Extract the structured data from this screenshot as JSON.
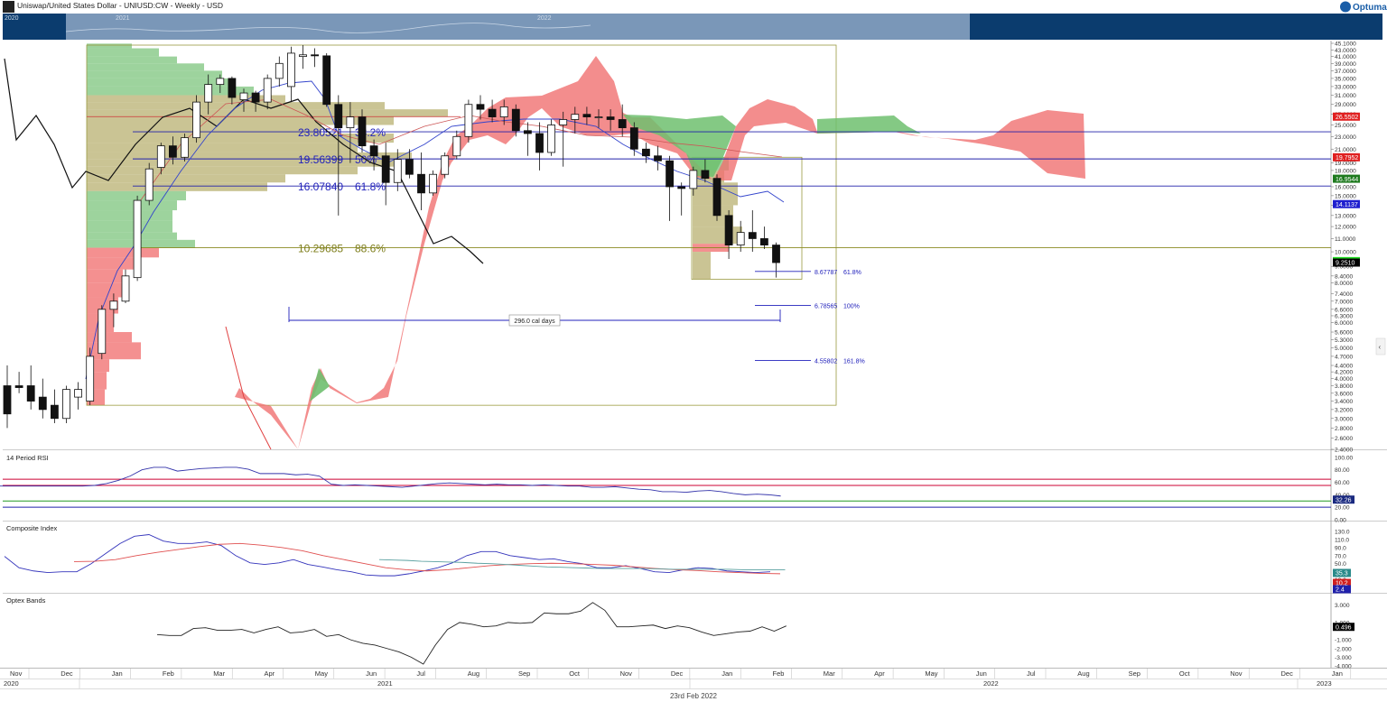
{
  "header": {
    "title": "Uniswap/United States Dollar - UNIUSD:CW - Weekly - USD",
    "brand": "Optuma",
    "nav_year_a": "2020",
    "nav_year_b": "2021",
    "nav_year_c": "2022",
    "footer_date": "23rd Feb 2022"
  },
  "colors": {
    "navigator_bg": "#0b3c6e",
    "navigator_window": "#7a97b8",
    "fib_blue": "#2222bb",
    "fib_olive": "#7d7d1a",
    "cloud_green": "#6fbf6f",
    "cloud_red": "#f07070",
    "volume_olive": "#b8b070",
    "volume_green": "#7cc47c",
    "volume_red": "#f06b6b",
    "rsi_line": "#3333aa",
    "ci_blue": "#3333bb",
    "ci_red": "#e05050",
    "ci_teal": "#5aa0a0",
    "optex_line": "#222222"
  },
  "fib_retracements": [
    {
      "price": "23.80521",
      "pct": "38.2%"
    },
    {
      "price": "19.56399",
      "pct": "50%"
    },
    {
      "price": "16.07840",
      "pct": "61.8%"
    },
    {
      "price": "10.29685",
      "pct": "88.6%"
    }
  ],
  "fib_extensions": [
    {
      "price": "8.67787",
      "pct": "61.8%"
    },
    {
      "price": "6.78565",
      "pct": "100%"
    },
    {
      "price": "4.55802",
      "pct": "161.8%"
    }
  ],
  "date_range_label": "296.0 cal days",
  "price_axis": {
    "ticks": [
      "45.1000",
      "43.0000",
      "41.0000",
      "39.0000",
      "37.0000",
      "35.0000",
      "33.0000",
      "31.0000",
      "29.0000",
      "27.0000",
      "25.0000",
      "23.0000",
      "21.0000",
      "19.0000",
      "18.0000",
      "16.0000",
      "15.0000",
      "14.0000",
      "13.0000",
      "12.0000",
      "11.0000",
      "10.0000",
      "9.0000",
      "8.4000",
      "8.0000",
      "7.4000",
      "7.0000",
      "6.6000",
      "6.3000",
      "6.0000",
      "5.6000",
      "5.3000",
      "5.0000",
      "4.7000",
      "4.4000",
      "4.2000",
      "4.0000",
      "3.8000",
      "3.6000",
      "3.4000",
      "3.2000",
      "3.0000",
      "2.8000",
      "2.6000",
      "2.4000"
    ],
    "badges": [
      {
        "text": "26.5502",
        "price": 26.5502,
        "color": "#e02020",
        "fg": "#ffffff"
      },
      {
        "text": "19.7952",
        "price": 19.7952,
        "color": "#e02020",
        "fg": "#ffffff"
      },
      {
        "text": "16.9544",
        "price": 16.9544,
        "color": "#1e7a1e",
        "fg": "#ffffff"
      },
      {
        "text": "14.1137",
        "price": 14.1137,
        "color": "#1f1fcf",
        "fg": "#ffffff"
      },
      {
        "text": "9.3510",
        "price": 9.351,
        "color": "#22dd22",
        "fg": "#000000"
      },
      {
        "text": "9.2510",
        "price": 9.251,
        "color": "#000000",
        "fg": "#ffffff"
      }
    ]
  },
  "chart_data": [
    {
      "type": "candlestick",
      "title": "Uniswap/United States Dollar - UNIUSD:CW - Weekly - USD",
      "scale": "log",
      "ylim": [
        2.4,
        45.1
      ],
      "horizontal_levels": [
        {
          "price": 23.80521,
          "label": "38.2%"
        },
        {
          "price": 19.56399,
          "label": "50%"
        },
        {
          "price": 16.0784,
          "label": "61.8%"
        },
        {
          "price": 10.29685,
          "label": "88.6%"
        }
      ],
      "candles": [
        {
          "o": 3.8,
          "h": 4.4,
          "l": 2.8,
          "c": 3.1
        },
        {
          "o": 3.8,
          "h": 4.2,
          "l": 3.6,
          "c": 3.75
        },
        {
          "o": 3.8,
          "h": 4.4,
          "l": 3.2,
          "c": 3.4
        },
        {
          "o": 3.5,
          "h": 4.0,
          "l": 3.0,
          "c": 3.2
        },
        {
          "o": 3.3,
          "h": 3.7,
          "l": 2.9,
          "c": 3.0
        },
        {
          "o": 3.0,
          "h": 3.8,
          "l": 2.9,
          "c": 3.7
        },
        {
          "o": 3.5,
          "h": 3.9,
          "l": 3.2,
          "c": 3.7
        },
        {
          "o": 3.4,
          "h": 5.0,
          "l": 3.3,
          "c": 4.7
        },
        {
          "o": 4.8,
          "h": 6.8,
          "l": 4.6,
          "c": 6.6
        },
        {
          "o": 6.6,
          "h": 7.4,
          "l": 5.8,
          "c": 7.0
        },
        {
          "o": 7.0,
          "h": 8.8,
          "l": 6.9,
          "c": 8.4
        },
        {
          "o": 8.3,
          "h": 15.0,
          "l": 8.1,
          "c": 14.5
        },
        {
          "o": 14.5,
          "h": 19.0,
          "l": 14.0,
          "c": 18.2
        },
        {
          "o": 18.4,
          "h": 22.0,
          "l": 17.5,
          "c": 21.5
        },
        {
          "o": 21.5,
          "h": 23.0,
          "l": 18.8,
          "c": 19.8
        },
        {
          "o": 19.8,
          "h": 23.5,
          "l": 19.2,
          "c": 22.8
        },
        {
          "o": 22.8,
          "h": 31.0,
          "l": 22.0,
          "c": 29.5
        },
        {
          "o": 29.5,
          "h": 36.0,
          "l": 27.0,
          "c": 33.5
        },
        {
          "o": 33.5,
          "h": 36.0,
          "l": 31.5,
          "c": 35.0
        },
        {
          "o": 35.0,
          "h": 35.5,
          "l": 29.0,
          "c": 30.5
        },
        {
          "o": 30.0,
          "h": 32.5,
          "l": 27.5,
          "c": 31.5
        },
        {
          "o": 31.5,
          "h": 32.0,
          "l": 27.5,
          "c": 29.5
        },
        {
          "o": 29.5,
          "h": 36.0,
          "l": 28.0,
          "c": 35.0
        },
        {
          "o": 35.0,
          "h": 41.0,
          "l": 33.0,
          "c": 39.0
        },
        {
          "o": 33.0,
          "h": 44.0,
          "l": 29.5,
          "c": 42.0
        },
        {
          "o": 41.0,
          "h": 44.5,
          "l": 37.5,
          "c": 41.5
        },
        {
          "o": 41.5,
          "h": 43.5,
          "l": 38.0,
          "c": 41.2
        },
        {
          "o": 41.2,
          "h": 42.0,
          "l": 28.5,
          "c": 29.0
        },
        {
          "o": 29.0,
          "h": 31.0,
          "l": 13.0,
          "c": 24.5
        },
        {
          "o": 24.5,
          "h": 29.5,
          "l": 19.0,
          "c": 26.5
        },
        {
          "o": 26.5,
          "h": 28.0,
          "l": 20.5,
          "c": 21.5
        },
        {
          "o": 21.5,
          "h": 22.5,
          "l": 18.0,
          "c": 20.0
        },
        {
          "o": 20.0,
          "h": 22.0,
          "l": 14.0,
          "c": 16.5
        },
        {
          "o": 16.5,
          "h": 21.0,
          "l": 15.5,
          "c": 19.5
        },
        {
          "o": 19.5,
          "h": 21.0,
          "l": 17.0,
          "c": 17.5
        },
        {
          "o": 17.5,
          "h": 20.5,
          "l": 13.5,
          "c": 15.3
        },
        {
          "o": 15.3,
          "h": 18.0,
          "l": 15.0,
          "c": 17.5
        },
        {
          "o": 17.5,
          "h": 20.5,
          "l": 17.0,
          "c": 20.0
        },
        {
          "o": 20.0,
          "h": 24.0,
          "l": 19.5,
          "c": 23.0
        },
        {
          "o": 23.0,
          "h": 30.0,
          "l": 22.0,
          "c": 29.0
        },
        {
          "o": 29.0,
          "h": 31.0,
          "l": 26.0,
          "c": 28.0
        },
        {
          "o": 28.0,
          "h": 30.0,
          "l": 25.5,
          "c": 26.5
        },
        {
          "o": 26.5,
          "h": 30.0,
          "l": 25.0,
          "c": 28.5
        },
        {
          "o": 28.0,
          "h": 29.0,
          "l": 23.0,
          "c": 24.0
        },
        {
          "o": 24.0,
          "h": 25.5,
          "l": 20.0,
          "c": 23.5
        },
        {
          "o": 23.5,
          "h": 25.5,
          "l": 18.0,
          "c": 20.5
        },
        {
          "o": 20.5,
          "h": 26.0,
          "l": 20.0,
          "c": 25.0
        },
        {
          "o": 25.0,
          "h": 27.5,
          "l": 18.5,
          "c": 26.0
        },
        {
          "o": 26.0,
          "h": 28.5,
          "l": 23.5,
          "c": 27.0
        },
        {
          "o": 27.0,
          "h": 28.5,
          "l": 25.0,
          "c": 26.5
        },
        {
          "o": 26.5,
          "h": 28.0,
          "l": 24.5,
          "c": 26.5
        },
        {
          "o": 26.5,
          "h": 28.0,
          "l": 24.0,
          "c": 26.0
        },
        {
          "o": 26.0,
          "h": 29.0,
          "l": 23.0,
          "c": 24.5
        },
        {
          "o": 24.5,
          "h": 25.5,
          "l": 20.0,
          "c": 21.0
        },
        {
          "o": 21.0,
          "h": 22.0,
          "l": 19.0,
          "c": 20.0
        },
        {
          "o": 20.0,
          "h": 21.5,
          "l": 18.0,
          "c": 19.3
        },
        {
          "o": 19.3,
          "h": 20.0,
          "l": 12.5,
          "c": 16.0
        },
        {
          "o": 16.0,
          "h": 16.5,
          "l": 13.0,
          "c": 15.8
        },
        {
          "o": 15.8,
          "h": 18.5,
          "l": 15.0,
          "c": 18.0
        },
        {
          "o": 18.0,
          "h": 19.5,
          "l": 16.5,
          "c": 17.0
        },
        {
          "o": 17.0,
          "h": 17.5,
          "l": 12.5,
          "c": 13.0
        },
        {
          "o": 13.0,
          "h": 13.5,
          "l": 9.5,
          "c": 10.5
        },
        {
          "o": 10.5,
          "h": 12.5,
          "l": 10.0,
          "c": 11.5
        },
        {
          "o": 11.5,
          "h": 13.5,
          "l": 10.0,
          "c": 11.0
        },
        {
          "o": 11.0,
          "h": 12.0,
          "l": 10.2,
          "c": 10.5
        },
        {
          "o": 10.5,
          "h": 10.7,
          "l": 8.3,
          "c": 9.25
        }
      ],
      "extension_targets": [
        {
          "price": 8.67787,
          "label": "61.8%"
        },
        {
          "price": 6.78565,
          "label": "100%"
        },
        {
          "price": 4.55802,
          "label": "161.8%"
        }
      ],
      "projection": {
        "label": "296.0 cal days"
      }
    },
    {
      "type": "line",
      "title": "14 Period RSI",
      "ylim": [
        0,
        110
      ],
      "ticks": [
        "100.00",
        "80.00",
        "60.00",
        "40.00",
        "20.00",
        "0.00"
      ],
      "levels": [
        {
          "value": 65,
          "color": "#cc0033"
        },
        {
          "value": 55,
          "color": "#cc0033"
        },
        {
          "value": 30,
          "color": "#229922"
        },
        {
          "value": 20,
          "color": "#2222aa"
        }
      ],
      "current": "32.26",
      "values": [
        null,
        null,
        null,
        null,
        null,
        null,
        null,
        null,
        null,
        null,
        null,
        null,
        null,
        null,
        null,
        null,
        null,
        null,
        null,
        null,
        null,
        null,
        null,
        null,
        null,
        null,
        null,
        null,
        null,
        null,
        null,
        null,
        null,
        null,
        null,
        null,
        null,
        null,
        null,
        null,
        null,
        null,
        null,
        null,
        null,
        null,
        null,
        null,
        null,
        null,
        null,
        null,
        null,
        null,
        null,
        null,
        null,
        null,
        null,
        null,
        null,
        null,
        null,
        null,
        null,
        null
      ]
    },
    {
      "type": "line",
      "title": "Composite Index",
      "ylim": [
        -20,
        150
      ],
      "ticks": [
        "130.0",
        "110.0",
        "90.0",
        "70.0",
        "50.0",
        "30.0",
        "10.0"
      ],
      "current": [
        "35.3",
        "10.2",
        "2.4"
      ]
    },
    {
      "type": "line",
      "title": "Optex Bands",
      "ylim": [
        -4,
        4
      ],
      "ticks": [
        "3.000",
        "1.000",
        "-1.000",
        "-2.000",
        "-3.000",
        "-4.000"
      ],
      "current": "0.496"
    }
  ],
  "rsi_series": [
    54,
    54,
    54,
    54,
    54,
    54,
    54,
    54,
    55,
    58,
    63,
    70,
    80,
    84,
    84,
    78,
    80,
    82,
    83,
    84,
    84,
    81,
    74,
    74,
    74,
    72,
    73,
    70,
    57,
    55,
    56,
    55,
    54,
    53,
    52,
    54,
    56,
    58,
    59,
    58,
    57,
    56,
    57,
    56,
    56,
    55,
    56,
    55,
    54,
    54,
    52,
    52,
    53,
    51,
    49,
    48,
    45,
    45,
    44,
    46,
    47,
    45,
    42,
    40,
    41,
    40,
    38
  ],
  "ci_blue": [
    68,
    40,
    32,
    28,
    30,
    30,
    50,
    75,
    100,
    118,
    122,
    106,
    100,
    100,
    104,
    95,
    70,
    52,
    48,
    52,
    60,
    48,
    42,
    35,
    30,
    22,
    20,
    20,
    25,
    32,
    40,
    52,
    70,
    80,
    80,
    70,
    65,
    60,
    62,
    55,
    50,
    40,
    40,
    45,
    38,
    30,
    28,
    35,
    40,
    38,
    32,
    30,
    28,
    30
  ],
  "ci_red": [
    55,
    56,
    60,
    70,
    78,
    85,
    92,
    98,
    100,
    96,
    90,
    82,
    70,
    60,
    50,
    40,
    35,
    32,
    35,
    40,
    45,
    48,
    50,
    51,
    50,
    48,
    46,
    42,
    38,
    35,
    33,
    30,
    28,
    26,
    25
  ],
  "ci_teal": [
    60,
    59,
    58,
    56,
    55,
    54,
    53,
    51,
    50,
    48,
    46,
    44,
    42,
    41,
    40,
    39,
    38,
    38,
    38,
    38,
    37,
    36,
    36,
    36,
    36,
    36,
    35,
    35,
    35,
    35
  ],
  "optex_series": [
    -0.4,
    -0.5,
    -0.5,
    0.3,
    0.4,
    0.1,
    0.1,
    0.2,
    -0.2,
    0.2,
    0.5,
    -0.2,
    -0.1,
    0.2,
    -0.6,
    -0.4,
    -1.0,
    -1.4,
    -1.6,
    -2.0,
    -2.4,
    -3.0,
    -3.8,
    -1.6,
    0.2,
    1.0,
    0.8,
    0.5,
    0.6,
    1.0,
    0.9,
    1.0,
    2.1,
    2.0,
    2.0,
    2.3,
    3.3,
    2.4,
    0.5,
    0.5,
    0.6,
    0.7,
    0.3,
    0.6,
    0.4,
    -0.1,
    -0.5,
    -0.3,
    -0.1,
    0.0,
    0.5,
    0.0,
    0.6
  ],
  "time_axis": {
    "months": [
      "Nov",
      "Dec",
      "Jan",
      "Feb",
      "Mar",
      "Apr",
      "May",
      "Jun",
      "Jul",
      "Aug",
      "Sep",
      "Oct",
      "Nov",
      "Dec",
      "Jan",
      "Feb",
      "Mar",
      "Apr",
      "May",
      "Jun",
      "Jul",
      "Aug",
      "Sep",
      "Oct",
      "Nov",
      "Dec",
      "Jan"
    ],
    "years": [
      "2020",
      "2021",
      "2022",
      "2023"
    ]
  }
}
